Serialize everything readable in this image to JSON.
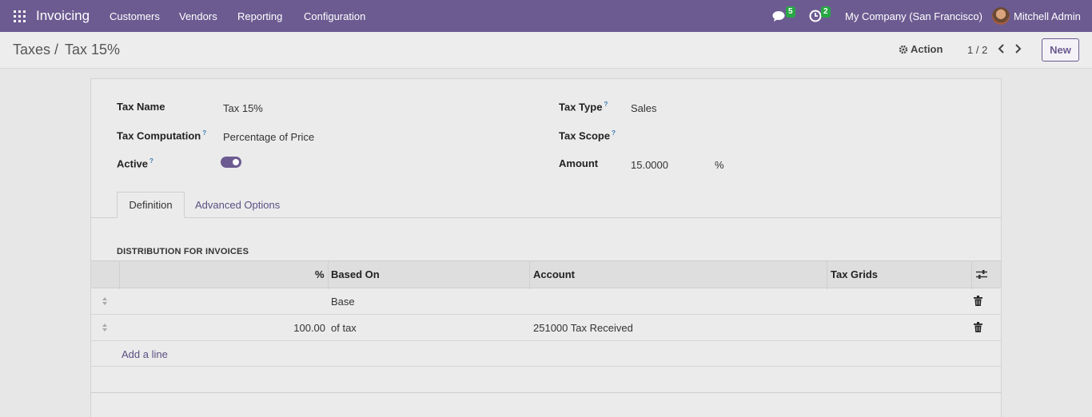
{
  "navbar": {
    "app_name": "Invoicing",
    "menu": [
      "Customers",
      "Vendors",
      "Reporting",
      "Configuration"
    ],
    "messages_count": "5",
    "activities_count": "2",
    "company": "My Company (San Francisco)",
    "user": "Mitchell Admin"
  },
  "breadcrumb": {
    "parent": "Taxes",
    "separator": "/",
    "current": "Tax 15%"
  },
  "control": {
    "action_label": "Action",
    "pager": "1 / 2",
    "new_label": "New"
  },
  "form": {
    "tax_name_label": "Tax Name",
    "tax_name_value": "Tax 15%",
    "tax_computation_label": "Tax Computation",
    "tax_computation_value": "Percentage of Price",
    "active_label": "Active",
    "active_value": true,
    "tax_type_label": "Tax Type",
    "tax_type_value": "Sales",
    "tax_scope_label": "Tax Scope",
    "tax_scope_value": "",
    "amount_label": "Amount",
    "amount_value": "15.0000",
    "amount_unit": "%",
    "help_marker": "?"
  },
  "tabs": {
    "definition": "Definition",
    "advanced": "Advanced Options"
  },
  "distribution": {
    "title": "DISTRIBUTION FOR INVOICES",
    "columns": [
      "%",
      "Based On",
      "Account",
      "Tax Grids"
    ],
    "rows": [
      {
        "percent": "",
        "based_on": "Base",
        "account": "",
        "tax_grids": ""
      },
      {
        "percent": "100.00",
        "based_on": "of tax",
        "account": "251000 Tax Received",
        "tax_grids": ""
      }
    ],
    "add_line": "Add a line"
  },
  "colors": {
    "brand": "#6c5b91",
    "badge": "#28a745"
  }
}
